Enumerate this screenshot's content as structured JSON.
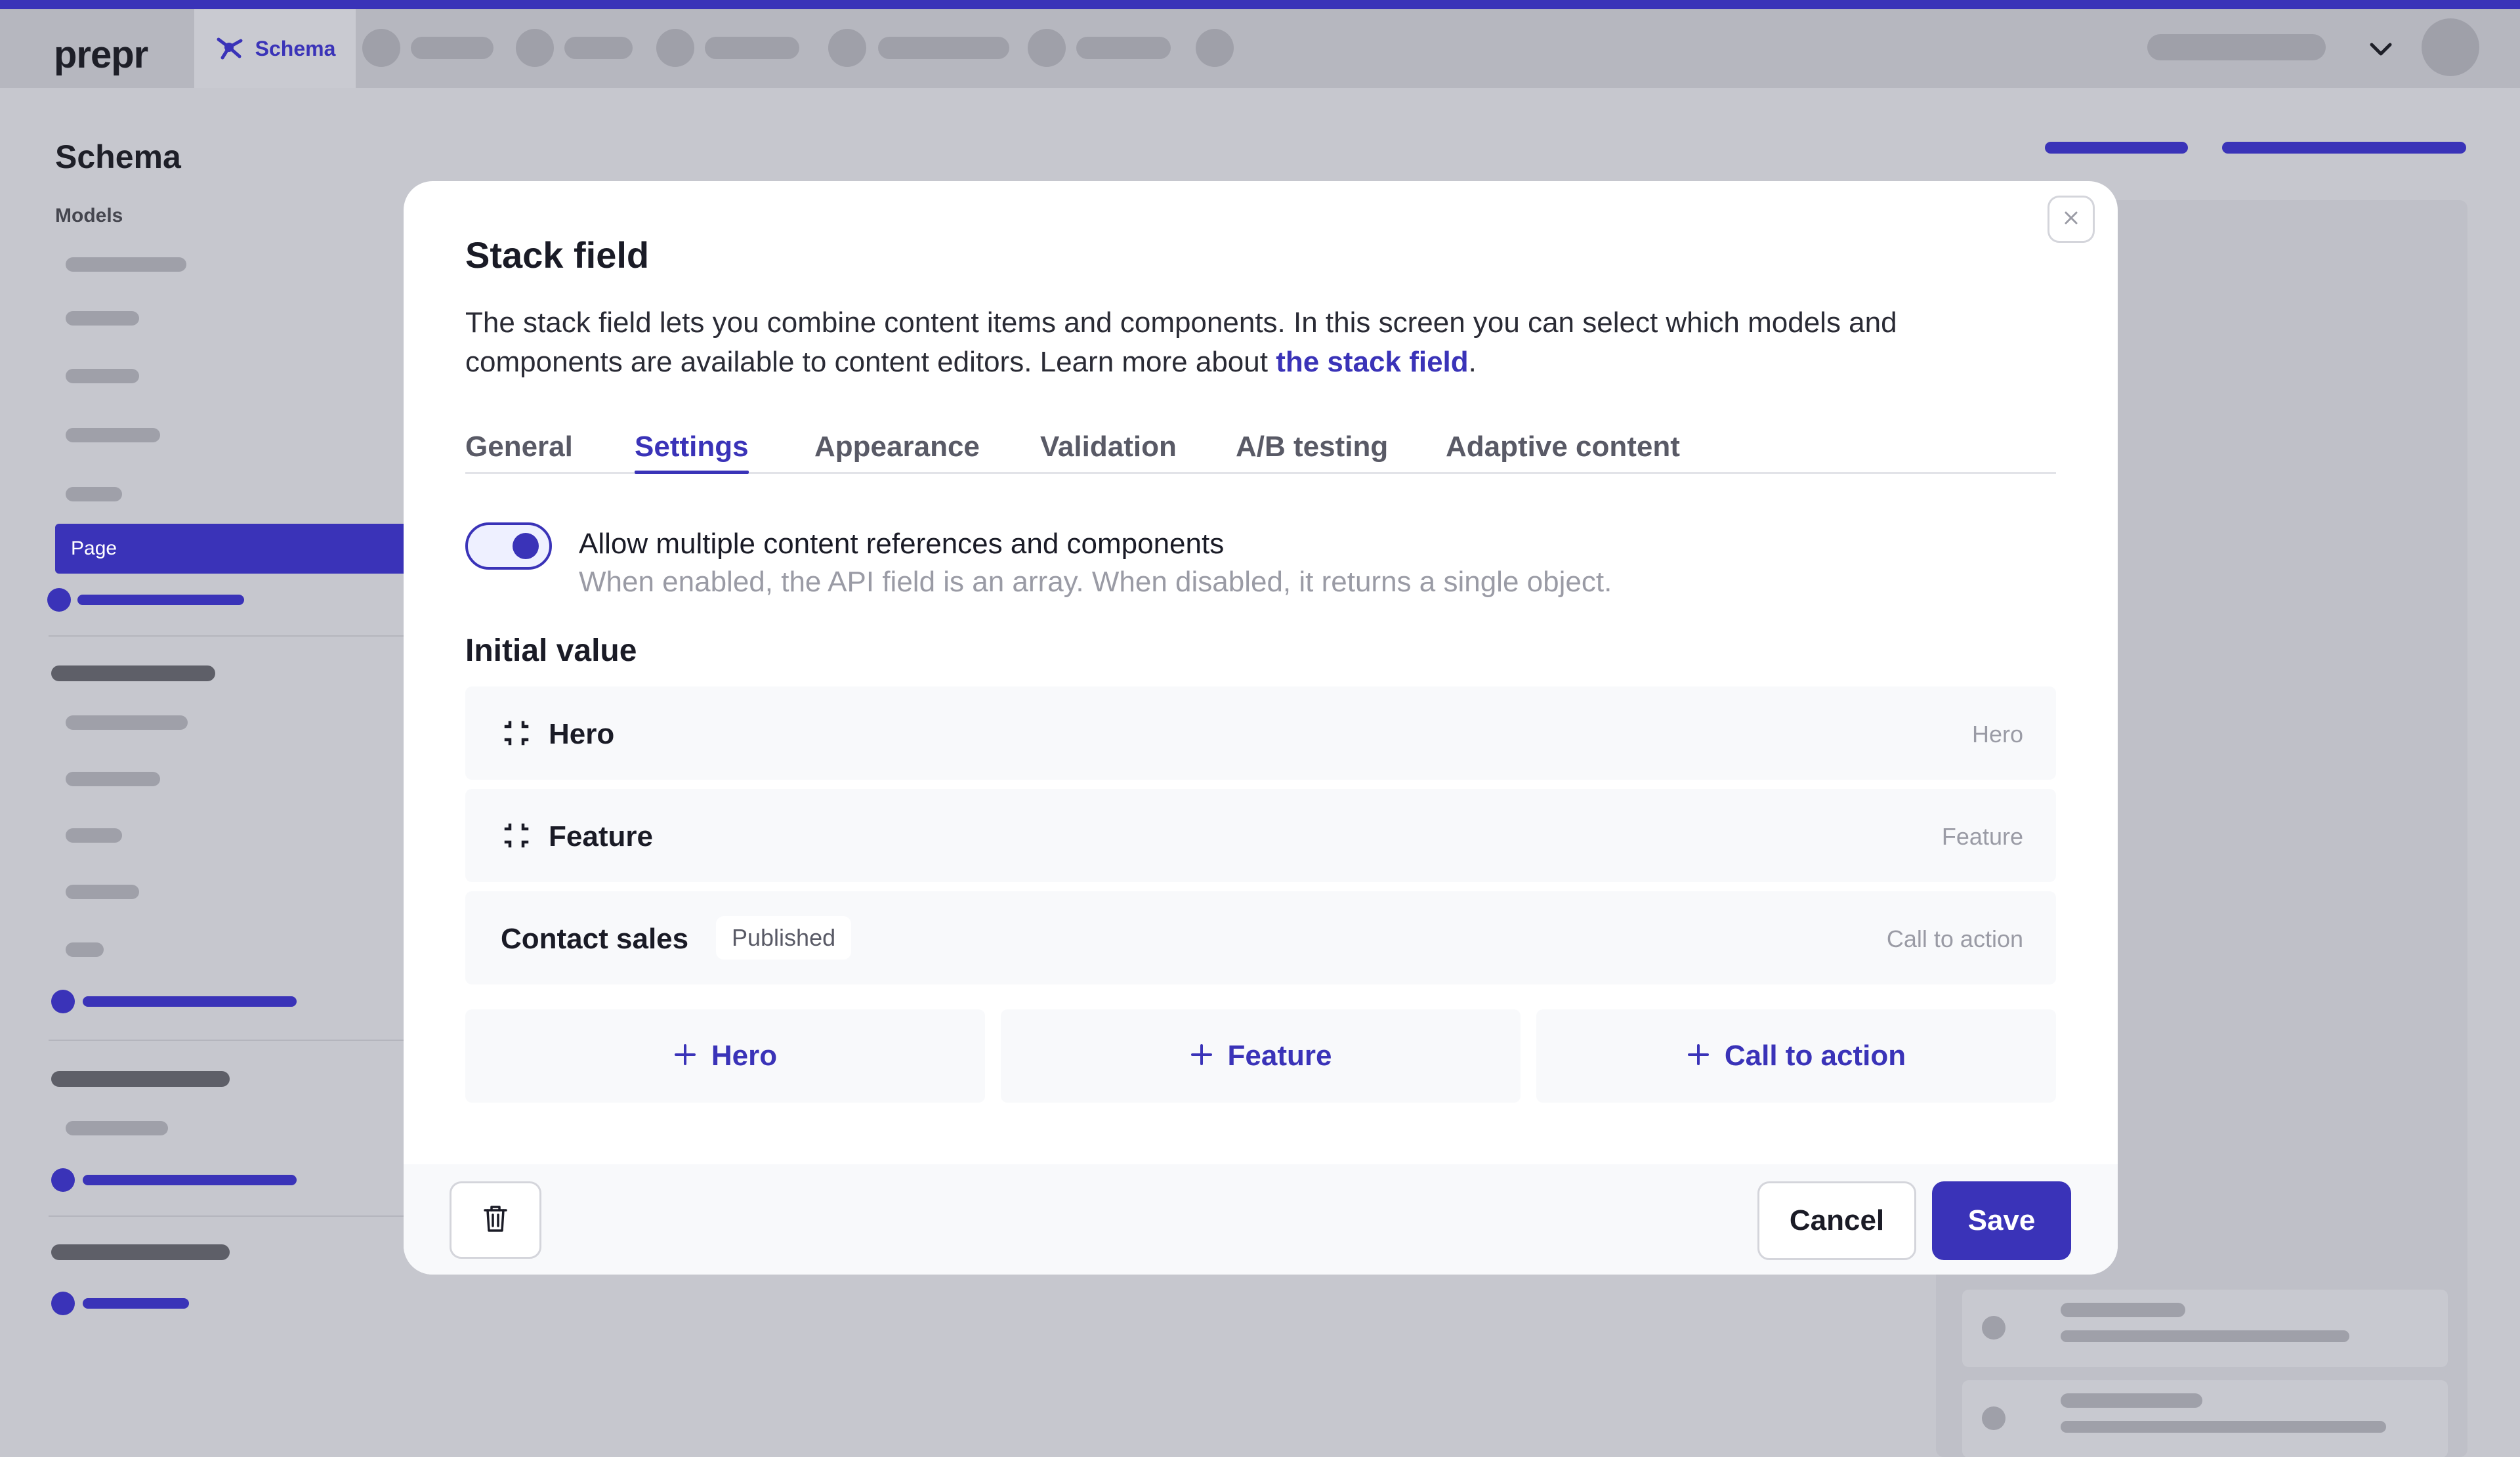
{
  "app": {
    "logo": "prepr",
    "active_tab": "Schema",
    "accent_color": "#3a33b8"
  },
  "sidebar": {
    "title": "Schema",
    "subtitle": "Models",
    "selected_item": "Page"
  },
  "modal": {
    "title": "Stack field",
    "description": "The stack field lets you combine content items and components. In this screen you can select which models and components are available to content editors. Learn more about ",
    "description_link": "the stack field",
    "description_end": ".",
    "tabs": [
      {
        "label": "General"
      },
      {
        "label": "Settings",
        "active": true
      },
      {
        "label": "Appearance"
      },
      {
        "label": "Validation"
      },
      {
        "label": "A/B testing"
      },
      {
        "label": "Adaptive content"
      }
    ],
    "toggle": {
      "enabled": true,
      "label": "Allow multiple content references and components",
      "help": "When enabled, the API field is an array. When disabled, it returns a single object."
    },
    "initial_value": {
      "title": "Initial value",
      "items": [
        {
          "name": "Hero",
          "type": "Hero",
          "icon": "component-icon"
        },
        {
          "name": "Feature",
          "type": "Feature",
          "icon": "component-icon"
        },
        {
          "name": "Contact sales",
          "type": "Call to action",
          "badge": "Published"
        }
      ],
      "add_buttons": [
        {
          "label": "Hero"
        },
        {
          "label": "Feature"
        },
        {
          "label": "Call to action"
        }
      ]
    },
    "footer": {
      "cancel": "Cancel",
      "save": "Save"
    }
  }
}
